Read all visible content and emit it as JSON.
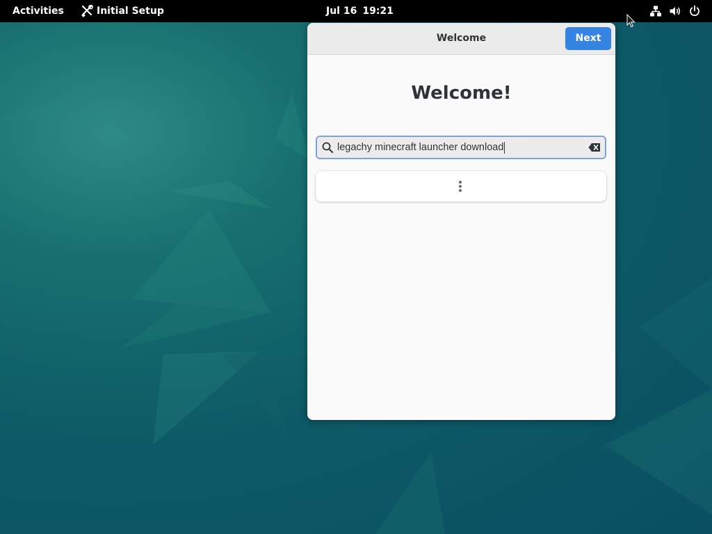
{
  "topbar": {
    "activities_label": "Activities",
    "app_name": "Initial Setup",
    "app_icon": "tools-icon",
    "date": "Jul 16",
    "time": "19:21",
    "system_icons": [
      "network-icon",
      "volume-icon",
      "power-icon"
    ]
  },
  "window": {
    "title": "Welcome",
    "next_label": "Next",
    "heading": "Welcome!",
    "search": {
      "value": "legachy minecraft launcher download",
      "placeholder": ""
    },
    "results_indicator_icon": "more-vertical-icon"
  },
  "colors": {
    "accent": "#3584e4",
    "topbar": "#000000",
    "window_bg": "#fafafa",
    "headerbar_bg": "#ebebeb",
    "wallpaper": "#0b5560"
  }
}
